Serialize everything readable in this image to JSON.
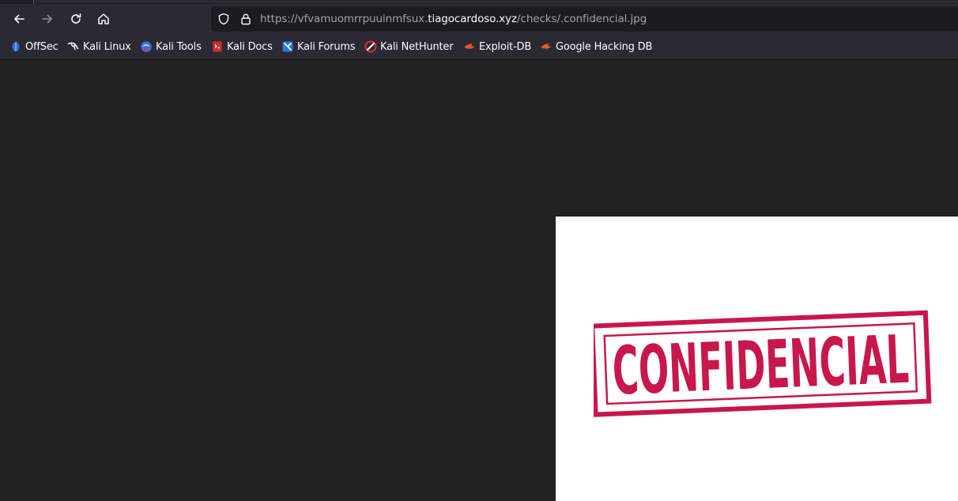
{
  "window": {
    "background": "#1c1b22",
    "toolbar_color": "#2b2a33"
  },
  "nav": {
    "back_icon": "arrow-left-icon",
    "forward_icon": "arrow-right-icon",
    "reload_icon": "reload-icon",
    "home_icon": "home-icon"
  },
  "urlbar": {
    "prefix": "https://vfvamuomrrpuuinmfsux.",
    "host": "tiagocardoso.xyz",
    "path": "/checks/.confidencial.jpg",
    "shield_icon": "shield-icon",
    "lock_icon": "lock-icon"
  },
  "bookmarks": [
    {
      "label": "OffSec",
      "icon": "offsec-icon"
    },
    {
      "label": "Kali Linux",
      "icon": "kali-dragon-icon"
    },
    {
      "label": "Kali Tools",
      "icon": "kali-tools-icon"
    },
    {
      "label": "Kali Docs",
      "icon": "kali-docs-icon"
    },
    {
      "label": "Kali Forums",
      "icon": "kali-forums-icon"
    },
    {
      "label": "Kali NetHunter",
      "icon": "nethunter-icon"
    },
    {
      "label": "Exploit-DB",
      "icon": "exploit-db-icon"
    },
    {
      "label": "Google Hacking DB",
      "icon": "ghdb-icon"
    }
  ],
  "content": {
    "background": "#222222",
    "image": {
      "background": "#ffffff",
      "stamp_text": "CONFIDENCIAL",
      "stamp_color": "#c8174a"
    }
  }
}
